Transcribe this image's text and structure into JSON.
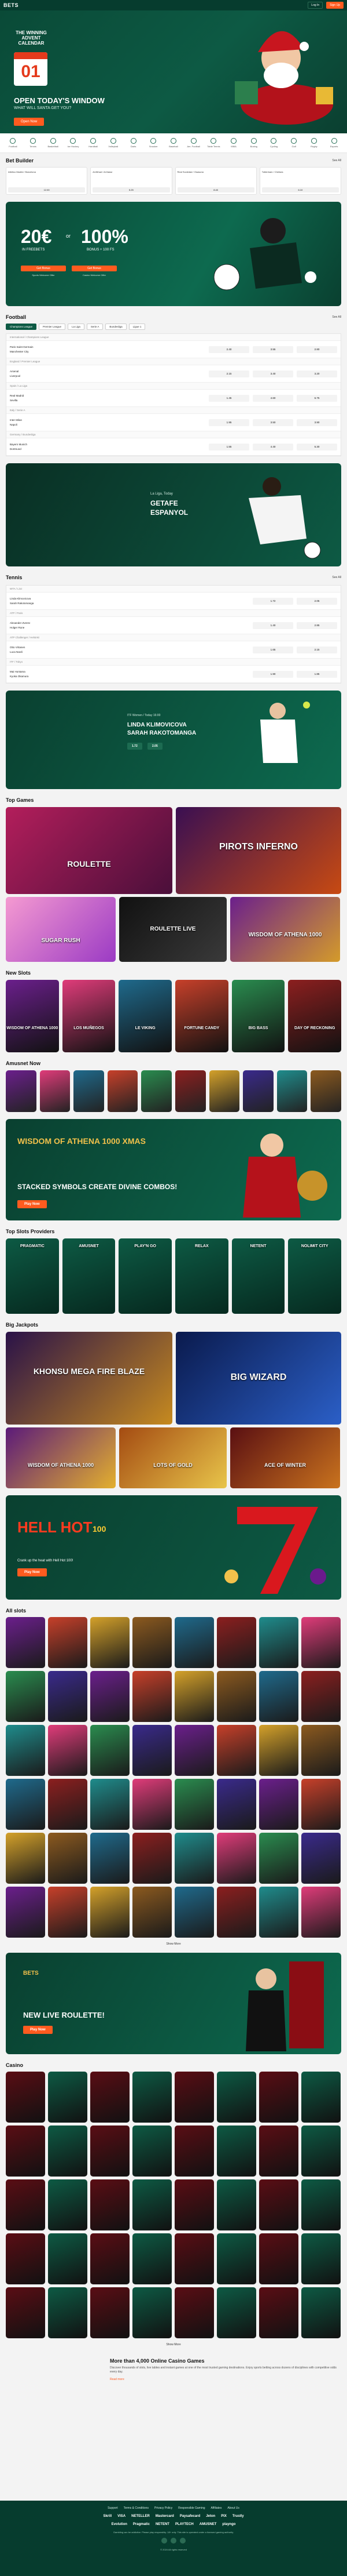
{
  "header": {
    "logo": "BETS",
    "login": "Log In",
    "signup": "Sign Up"
  },
  "hero": {
    "cal_title": "THE WINNING ADVENT CALENDAR",
    "cal_day": "01",
    "title": "OPEN TODAY'S WINDOW",
    "subtitle": "WHAT WILL SANTA GET YOU?",
    "cta": "Open Now"
  },
  "sports": [
    {
      "label": "Football"
    },
    {
      "label": "Tennis"
    },
    {
      "label": "Basketball"
    },
    {
      "label": "Ice Hockey"
    },
    {
      "label": "Handball"
    },
    {
      "label": "Volleyball"
    },
    {
      "label": "Darts"
    },
    {
      "label": "Snooker"
    },
    {
      "label": "Baseball"
    },
    {
      "label": "Am. Football"
    },
    {
      "label": "Table Tennis"
    },
    {
      "label": "MMA"
    },
    {
      "label": "Boxing"
    },
    {
      "label": "Cycling"
    },
    {
      "label": "Golf"
    },
    {
      "label": "Rugby"
    },
    {
      "label": "Esports"
    }
  ],
  "bet_builder": {
    "title": "Bet Builder",
    "see_all": "See All",
    "cards": [
      {
        "teams": "Atletico Madrid / Barcelona",
        "odd": "12.00"
      },
      {
        "teams": "Al-Ittihad / Al-Nassr",
        "odd": "5.25"
      },
      {
        "teams": "Real Sociedad / Osasuna",
        "odd": "8.40"
      },
      {
        "teams": "Tottenham / Chelsea",
        "odd": "6.10"
      }
    ]
  },
  "promo": {
    "amount": "20€",
    "amount_sub": "IN FREEBETS",
    "or": "or",
    "pct": "100%",
    "pct_sub": "BONUS + 100 FS",
    "btn1": "Get Bonus",
    "btn2": "Get Bonus",
    "note1": "Sports Welcome Offer",
    "note2": "Casino Welcome Offer"
  },
  "football": {
    "title": "Football",
    "see_all": "See All",
    "tabs": [
      "Champions League",
      "Premier League",
      "La Liga",
      "Serie A",
      "Bundesliga",
      "Ligue 1"
    ],
    "rows": [
      {
        "league": "International / Champions League",
        "teams": "Paris Saint-Germain\nManchester City",
        "o1": "2.40",
        "ox": "3.55",
        "o2": "2.80"
      },
      {
        "league": "England / Premier League",
        "teams": "Arsenal\nLiverpool",
        "o1": "2.15",
        "ox": "3.40",
        "o2": "3.20"
      },
      {
        "league": "Spain / La Liga",
        "teams": "Real Madrid\nSevilla",
        "o1": "1.45",
        "ox": "4.60",
        "o2": "6.75"
      },
      {
        "league": "Italy / Serie A",
        "teams": "Inter Milan\nNapoli",
        "o1": "1.95",
        "ox": "3.50",
        "o2": "3.90"
      },
      {
        "league": "Germany / Bundesliga",
        "teams": "Bayern Munich\nDortmund",
        "o1": "1.55",
        "ox": "4.40",
        "o2": "5.30"
      }
    ]
  },
  "match_banner": {
    "league": "La Liga, Today",
    "home": "GETAFE",
    "away": "ESPANYOL"
  },
  "tennis": {
    "title": "Tennis",
    "see_all": "See All",
    "rows": [
      {
        "league": "WTA / Linz",
        "teams": "Linda Klimovicova\nSarah Rakotomanga",
        "o1": "1.72",
        "o2": "2.05"
      },
      {
        "league": "ATP / Paris",
        "teams": "Alexander Zverev\nHolger Rune",
        "o1": "1.40",
        "o2": "2.85"
      },
      {
        "league": "ATP Challenger / Helsinki",
        "teams": "Otto Virtanen\nLuca Nardi",
        "o1": "1.65",
        "o2": "2.15"
      },
      {
        "league": "ITF / Tokyo",
        "teams": "Mai Hontama\nKyoka Okamura",
        "o1": "1.90",
        "o2": "1.85"
      }
    ]
  },
  "tennis_banner": {
    "tag": "ITF Women / Today 16:00",
    "p1": "LINDA KLIMOVICOVA",
    "p2": "SARAH RAKOTOMANGA",
    "o1": "1.72",
    "o2": "2.05"
  },
  "top_games": {
    "title": "Top Games",
    "games": [
      "ROULETTE",
      "PIROTS INFERNO",
      "SUGAR RUSH",
      "ROULETTE LIVE",
      "WISDOM OF ATHENA 1000"
    ]
  },
  "new_slots": {
    "title": "New Slots",
    "games": [
      "WISDOM OF ATHENA 1000",
      "LOS MUÑEGOS",
      "LE VIKING",
      "FORTUNE CANDY",
      "BIG BASS",
      "DAY OF RECKONING"
    ]
  },
  "amusnet": {
    "title": "Amusnet Now",
    "tiles": 10
  },
  "divine_banner": {
    "game": "WISDOM OF ATHENA 1000 XMAS",
    "headline": "STACKED SYMBOLS CREATE DIVINE COMBOS!",
    "cta": "Play Now"
  },
  "providers": {
    "title": "Top Slots Providers",
    "list": [
      "PRAGMATIC",
      "AMUSNET",
      "PLAY'N GO",
      "RELAX",
      "NETENT",
      "NOLIMIT CITY"
    ]
  },
  "jackpots": {
    "title": "Big Jackpots",
    "games": [
      "KHONSU MEGA FIRE BLAZE",
      "BIG WIZARD",
      "WISDOM OF ATHENA 1000",
      "LOTS OF GOLD",
      "BOOK OF FORTUNE",
      "ACE OF WINTER"
    ]
  },
  "hellhot": {
    "title": "HELL HOT",
    "sub": "100",
    "note": "Crank up the heat with Hell Hot 100!",
    "cta": "Play Now"
  },
  "all_slots": {
    "title": "All slots",
    "show_more": "Show More"
  },
  "roulette_banner": {
    "badge": "BETS",
    "title": "NEW LIVE ROULETTE!",
    "cta": "Play Now"
  },
  "casino": {
    "title": "Casino",
    "show_more": "Show More"
  },
  "seo": {
    "title": "More than 4,000 Online Casino Games",
    "text": "Discover thousands of slots, live tables and instant games at one of the most trusted gaming destinations. Enjoy sports betting across dozens of disciplines with competitive odds every day.",
    "more": "Read more"
  },
  "footer": {
    "links": [
      "Support",
      "Terms & Conditions",
      "Privacy Policy",
      "Responsible Gaming",
      "Affiliates",
      "About Us"
    ],
    "payments": [
      "Skrill",
      "VISA",
      "NETELLER",
      "Mastercard",
      "Paysafecard",
      "Jeton",
      "PIX",
      "Trustly"
    ],
    "partners": [
      "Evolution",
      "Pragmatic",
      "NETENT",
      "PLAYTECH",
      "AMUSNET",
      "playngo"
    ],
    "legal": "Gambling can be addictive. Please play responsibly. 18+ only. This site is operated under a licensed gaming authority.",
    "copyright": "© 2024 All rights reserved"
  }
}
